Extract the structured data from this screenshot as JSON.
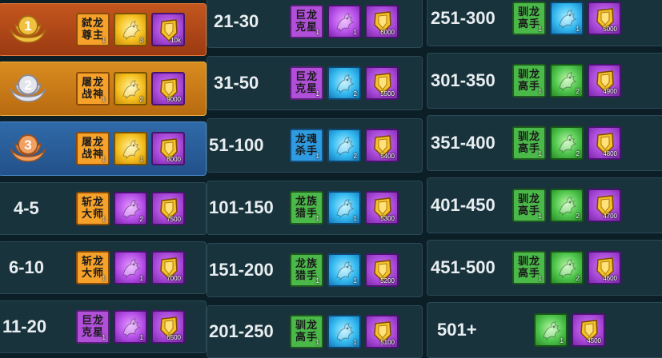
{
  "rows": [
    {
      "rank": "1",
      "medal": "gold",
      "items": [
        {
          "type": "title",
          "label": "弑龙\n尊主",
          "count": "1",
          "color": "orange"
        },
        {
          "type": "dragon",
          "color": "gold",
          "count": "3"
        },
        {
          "type": "medal",
          "count": "10k"
        }
      ]
    },
    {
      "rank": "2",
      "medal": "silver",
      "items": [
        {
          "type": "title",
          "label": "屠龙\n战神",
          "count": "1",
          "color": "orange"
        },
        {
          "type": "dragon",
          "color": "gold",
          "count": "2"
        },
        {
          "type": "medal",
          "count": "9000"
        }
      ]
    },
    {
      "rank": "3",
      "medal": "bronze",
      "items": [
        {
          "type": "title",
          "label": "屠龙\n战神",
          "count": "1",
          "color": "orange"
        },
        {
          "type": "dragon",
          "color": "gold",
          "count": "1"
        },
        {
          "type": "medal",
          "count": "8000"
        }
      ]
    },
    {
      "rank": "4-5",
      "items": [
        {
          "type": "title",
          "label": "斩龙\n大师",
          "count": "1",
          "color": "orange"
        },
        {
          "type": "dragon",
          "color": "purple",
          "count": "2"
        },
        {
          "type": "medal",
          "count": "7500"
        }
      ]
    },
    {
      "rank": "6-10",
      "items": [
        {
          "type": "title",
          "label": "斩龙\n大师",
          "count": "1",
          "color": "orange"
        },
        {
          "type": "dragon",
          "color": "purple",
          "count": "1"
        },
        {
          "type": "medal",
          "count": "7000"
        }
      ]
    },
    {
      "rank": "11-20",
      "items": [
        {
          "type": "title",
          "label": "巨龙\n克星",
          "count": "1",
          "color": "purple"
        },
        {
          "type": "dragon",
          "color": "purple",
          "count": "1"
        },
        {
          "type": "medal",
          "count": "6500"
        }
      ]
    },
    {
      "rank": "21-30",
      "items": [
        {
          "type": "title",
          "label": "巨龙\n克星",
          "count": "1",
          "color": "purple"
        },
        {
          "type": "dragon",
          "color": "purple",
          "count": "1"
        },
        {
          "type": "medal",
          "count": "6000"
        }
      ]
    },
    {
      "rank": "31-50",
      "items": [
        {
          "type": "title",
          "label": "巨龙\n克星",
          "count": "1",
          "color": "purple"
        },
        {
          "type": "dragon",
          "color": "blue",
          "count": "2"
        },
        {
          "type": "medal",
          "count": "5500"
        }
      ]
    },
    {
      "rank": "51-100",
      "items": [
        {
          "type": "title",
          "label": "龙魂\n杀手",
          "count": "1",
          "color": "blue"
        },
        {
          "type": "dragon",
          "color": "blue",
          "count": "2"
        },
        {
          "type": "medal",
          "count": "5400"
        }
      ]
    },
    {
      "rank": "101-150",
      "items": [
        {
          "type": "title",
          "label": "龙族\n猎手",
          "count": "1",
          "color": "green"
        },
        {
          "type": "dragon",
          "color": "blue",
          "count": "1"
        },
        {
          "type": "medal",
          "count": "5300"
        }
      ]
    },
    {
      "rank": "151-200",
      "items": [
        {
          "type": "title",
          "label": "龙族\n猎手",
          "count": "1",
          "color": "green"
        },
        {
          "type": "dragon",
          "color": "blue",
          "count": "1"
        },
        {
          "type": "medal",
          "count": "5200"
        }
      ]
    },
    {
      "rank": "201-250",
      "items": [
        {
          "type": "title",
          "label": "驯龙\n高手",
          "count": "1",
          "color": "green"
        },
        {
          "type": "dragon",
          "color": "blue",
          "count": "1"
        },
        {
          "type": "medal",
          "count": "5100"
        }
      ]
    },
    {
      "rank": "251-300",
      "items": [
        {
          "type": "title",
          "label": "驯龙\n高手",
          "count": "1",
          "color": "green"
        },
        {
          "type": "dragon",
          "color": "blue",
          "count": "1"
        },
        {
          "type": "medal",
          "count": "5000"
        }
      ]
    },
    {
      "rank": "301-350",
      "items": [
        {
          "type": "title",
          "label": "驯龙\n高手",
          "count": "1",
          "color": "green"
        },
        {
          "type": "dragon",
          "color": "green",
          "count": "2"
        },
        {
          "type": "medal",
          "count": "4900"
        }
      ]
    },
    {
      "rank": "351-400",
      "items": [
        {
          "type": "title",
          "label": "驯龙\n高手",
          "count": "1",
          "color": "green"
        },
        {
          "type": "dragon",
          "color": "green",
          "count": "2"
        },
        {
          "type": "medal",
          "count": "4800"
        }
      ]
    },
    {
      "rank": "401-450",
      "items": [
        {
          "type": "title",
          "label": "驯龙\n高手",
          "count": "1",
          "color": "green"
        },
        {
          "type": "dragon",
          "color": "green",
          "count": "2"
        },
        {
          "type": "medal",
          "count": "4700"
        }
      ]
    },
    {
      "rank": "451-500",
      "items": [
        {
          "type": "title",
          "label": "驯龙\n高手",
          "count": "1",
          "color": "green"
        },
        {
          "type": "dragon",
          "color": "green",
          "count": "2"
        },
        {
          "type": "medal",
          "count": "4600"
        }
      ]
    },
    {
      "rank": "501+",
      "items": [
        {
          "type": "dragon",
          "color": "green",
          "count": "1"
        },
        {
          "type": "medal",
          "count": "4500"
        }
      ]
    }
  ],
  "icons": {
    "dragon": "dragon-icon",
    "medal": "gold-shield-medal-icon"
  }
}
